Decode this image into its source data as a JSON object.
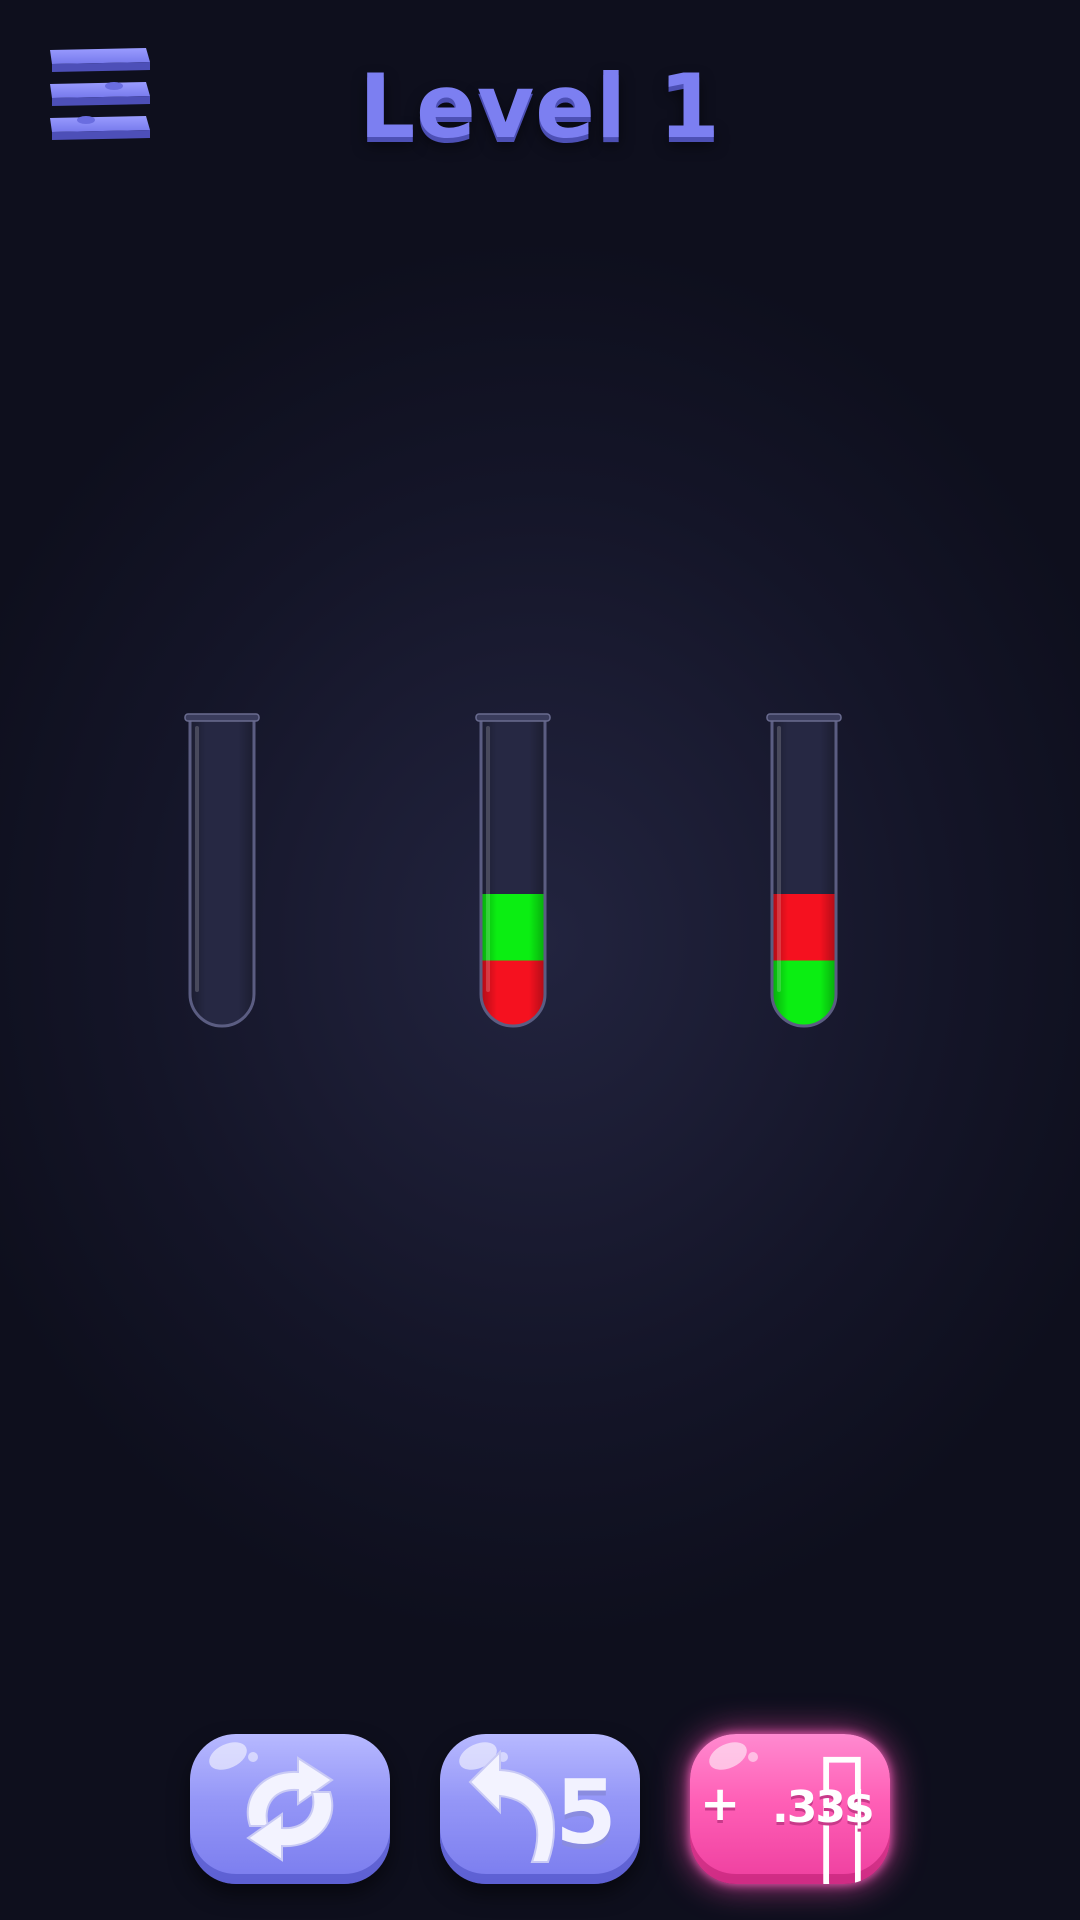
{
  "header": {
    "menu_icon": "hamburger-menu-icon",
    "level_title": "Level 1"
  },
  "tubes": [
    {
      "id": "tube-1",
      "layers": []
    },
    {
      "id": "tube-2",
      "layers": [
        "red",
        "green"
      ]
    },
    {
      "id": "tube-3",
      "layers": [
        "green",
        "red"
      ]
    }
  ],
  "tube_capacity": 4,
  "colors": {
    "red": "#f5111f",
    "green": "#0bee12",
    "accent": "#7c7ff1",
    "button_blue": "#9496f7",
    "button_pink": "#ff5fb6"
  },
  "controls": {
    "restart_icon": "restart-arrows-icon",
    "undo_icon": "undo-arrow-icon",
    "undo_count": "5",
    "add_tube_plus": "+",
    "add_tube_icon": "test-tube-icon",
    "add_tube_price": ".33$"
  }
}
